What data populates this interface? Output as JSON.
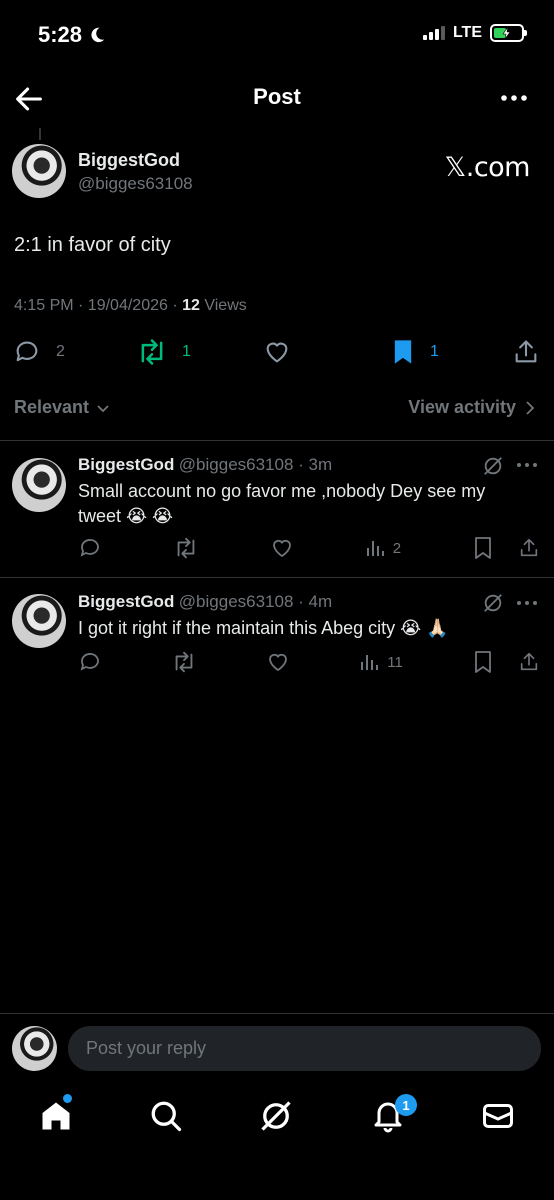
{
  "status_bar": {
    "time": "5:28",
    "network": "LTE"
  },
  "header": {
    "title": "Post"
  },
  "post": {
    "name": "BiggestGod",
    "handle": "@bigges63108",
    "watermark": "𝕏.com",
    "text": "2:1 in favor of city",
    "time": "4:15 PM · 19/04/2026 · ",
    "views_count": "12",
    "views_label": " Views",
    "replies": "2",
    "reposts": "1",
    "bookmarks": "1"
  },
  "sort": {
    "relevant": "Relevant",
    "view_activity": "View activity"
  },
  "replies": [
    {
      "name": "BiggestGod",
      "handle_time": "@bigges63108 · 3m",
      "text": "Small account no go favor me ,nobody Dey see my tweet 😭 😭",
      "views": "2"
    },
    {
      "name": "BiggestGod",
      "handle_time": "@bigges63108 · 4m",
      "text": "I got it right if the maintain this Abeg city 😭 🙏🏻",
      "views": "11"
    }
  ],
  "composer": {
    "placeholder": "Post your reply"
  },
  "bottom_nav": {
    "notifications_badge": "1"
  },
  "colors": {
    "background": "#000000",
    "accent": "#1d9bf0",
    "repost_green": "#00ba7c",
    "muted": "#71767b"
  }
}
